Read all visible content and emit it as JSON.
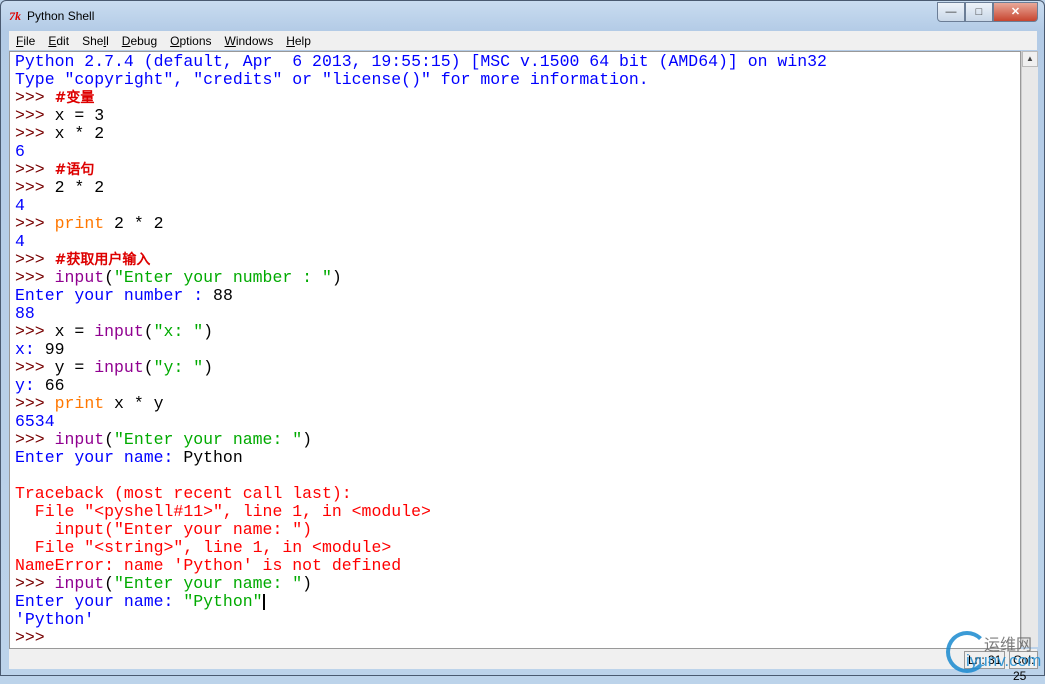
{
  "window": {
    "title": "Python Shell",
    "icon": "tk-feather-icon",
    "controls": {
      "minimize": "—",
      "maximize": "□",
      "close": "✕"
    }
  },
  "menu": [
    {
      "u": "F",
      "rest": "ile"
    },
    {
      "u": "E",
      "rest": "dit"
    },
    {
      "pre": "She",
      "u": "l",
      "rest": "l"
    },
    {
      "u": "D",
      "rest": "ebug"
    },
    {
      "u": "O",
      "rest": "ptions"
    },
    {
      "u": "W",
      "rest": "indows"
    },
    {
      "u": "H",
      "rest": "elp"
    }
  ],
  "shell": {
    "lines": [
      [
        [
          "stdout",
          "Python 2.7.4 (default, Apr  6 2013, 19:55:15) [MSC v.1500 64 bit (AMD64)] on win32"
        ]
      ],
      [
        [
          "stdout",
          "Type \"copyright\", \"credits\" or \"license()\" for more information."
        ]
      ],
      [
        [
          "console",
          ">>> "
        ],
        [
          "cm",
          "#变量"
        ]
      ],
      [
        [
          "console",
          ">>> "
        ],
        [
          "stdin",
          "x = 3"
        ]
      ],
      [
        [
          "console",
          ">>> "
        ],
        [
          "stdin",
          "x * 2"
        ]
      ],
      [
        [
          "stdout",
          "6"
        ]
      ],
      [
        [
          "console",
          ">>> "
        ],
        [
          "cm",
          "#语句"
        ]
      ],
      [
        [
          "console",
          ">>> "
        ],
        [
          "stdin",
          "2 * 2"
        ]
      ],
      [
        [
          "stdout",
          "4"
        ]
      ],
      [
        [
          "console",
          ">>> "
        ],
        [
          "kw",
          "print"
        ],
        [
          "stdin",
          " 2 * 2"
        ]
      ],
      [
        [
          "stdout",
          "4"
        ]
      ],
      [
        [
          "console",
          ">>> "
        ],
        [
          "cm",
          "#获取用户输入"
        ]
      ],
      [
        [
          "console",
          ">>> "
        ],
        [
          "bi",
          "input"
        ],
        [
          "stdin",
          "("
        ],
        [
          "str",
          "\"Enter your number : \""
        ],
        [
          "stdin",
          ")"
        ]
      ],
      [
        [
          "stdout",
          "Enter your number : "
        ],
        [
          "stdin",
          "88"
        ]
      ],
      [
        [
          "stdout",
          "88"
        ]
      ],
      [
        [
          "console",
          ">>> "
        ],
        [
          "stdin",
          "x = "
        ],
        [
          "bi",
          "input"
        ],
        [
          "stdin",
          "("
        ],
        [
          "str",
          "\"x: \""
        ],
        [
          "stdin",
          ")"
        ]
      ],
      [
        [
          "stdout",
          "x: "
        ],
        [
          "stdin",
          "99"
        ]
      ],
      [
        [
          "console",
          ">>> "
        ],
        [
          "stdin",
          "y = "
        ],
        [
          "bi",
          "input"
        ],
        [
          "stdin",
          "("
        ],
        [
          "str",
          "\"y: \""
        ],
        [
          "stdin",
          ")"
        ]
      ],
      [
        [
          "stdout",
          "y: "
        ],
        [
          "stdin",
          "66"
        ]
      ],
      [
        [
          "console",
          ">>> "
        ],
        [
          "kw",
          "print"
        ],
        [
          "stdin",
          " x * y"
        ]
      ],
      [
        [
          "stdout",
          "6534"
        ]
      ],
      [
        [
          "console",
          ">>> "
        ],
        [
          "bi",
          "input"
        ],
        [
          "stdin",
          "("
        ],
        [
          "str",
          "\"Enter your name: \""
        ],
        [
          "stdin",
          ")"
        ]
      ],
      [
        [
          "stdout",
          "Enter your name: "
        ],
        [
          "stdin",
          "Python"
        ]
      ],
      [],
      [
        [
          "err",
          "Traceback (most recent call last):"
        ]
      ],
      [
        [
          "err",
          "  File \"<pyshell#11>\", line 1, in <module>"
        ]
      ],
      [
        [
          "err",
          "    input(\"Enter your name: \")"
        ]
      ],
      [
        [
          "err",
          "  File \"<string>\", line 1, in <module>"
        ]
      ],
      [
        [
          "err",
          "NameError: name 'Python' is not defined"
        ]
      ],
      [
        [
          "console",
          ">>> "
        ],
        [
          "bi",
          "input"
        ],
        [
          "stdin",
          "("
        ],
        [
          "str",
          "\"Enter your name: \""
        ],
        [
          "stdin",
          ")"
        ]
      ],
      [
        [
          "stdout",
          "Enter your name: "
        ],
        [
          "str",
          "\"Python\""
        ],
        [
          "cursor",
          ""
        ]
      ],
      [
        [
          "stdout",
          "'Python'"
        ]
      ],
      [
        [
          "console",
          ">>> "
        ]
      ]
    ]
  },
  "status": {
    "line": "Ln: 31",
    "col": "Col: 25"
  },
  "watermark": {
    "cn": "运维网",
    "en": "iyunv.com"
  }
}
